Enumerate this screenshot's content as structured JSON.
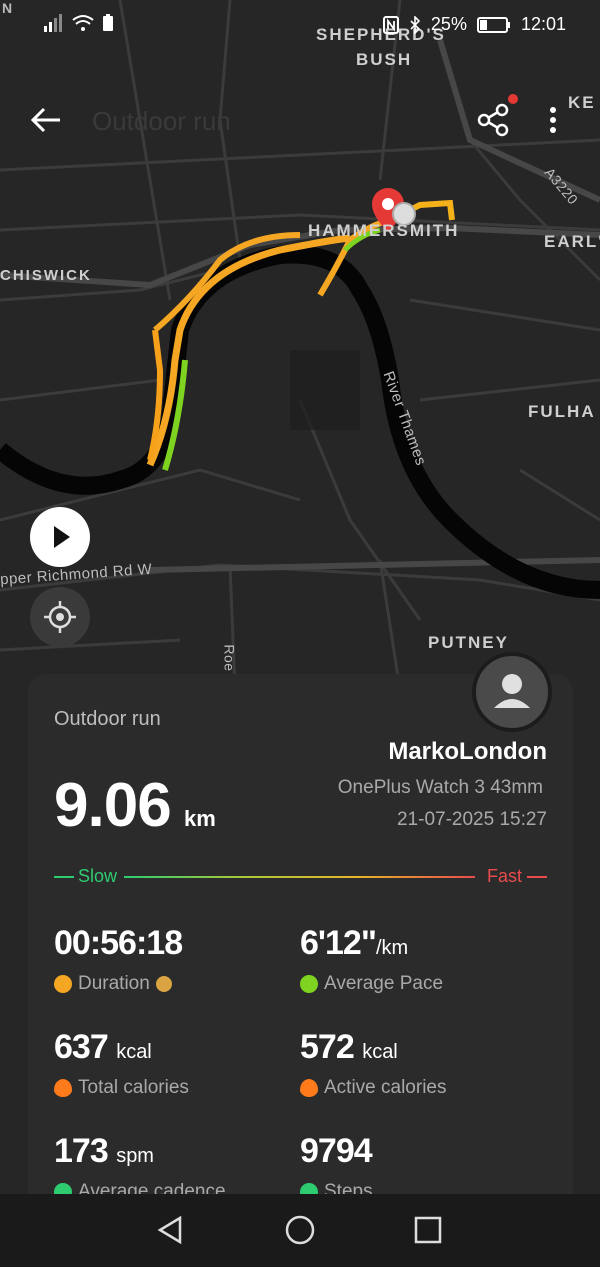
{
  "status_bar": {
    "corner": "N",
    "battery_percent": "25%",
    "time": "12:01"
  },
  "top_bar": {
    "faded_title": "Outdoor run",
    "icons": [
      "back-arrow-icon",
      "share-icon",
      "more-vertical-icon"
    ]
  },
  "map": {
    "labels": {
      "shepherds_bush_1": "SHEPHERD'S",
      "shepherds_bush_2": "BUSH",
      "hammersmith": "HAMMERSMITH",
      "chiswick": "CHISWICK",
      "fulham": "FULHA",
      "earls": "EARL'",
      "putney": "PUTNEY",
      "river": "River Thames",
      "road_a3220": "A3220",
      "upper_richmond": "pper Richmond Rd W",
      "ke": "KE",
      "roe": "Roe"
    },
    "controls": [
      "play-icon",
      "locate-icon"
    ]
  },
  "summary": {
    "title": "Outdoor run",
    "distance": "9.06",
    "distance_unit": "km",
    "username": "MarkoLondon",
    "device": "OnePlus Watch 3 43mm",
    "datetime": "21-07-2025 15:27",
    "legend_slow": "Slow",
    "legend_fast": "Fast",
    "stats": [
      {
        "value": "00:56:18",
        "unit": "",
        "label": "Duration"
      },
      {
        "value": "6'12\"",
        "unit": "/km",
        "label": "Average Pace"
      },
      {
        "value": "637",
        "unit": "kcal",
        "label": "Total calories"
      },
      {
        "value": "572",
        "unit": "kcal",
        "label": "Active calories"
      },
      {
        "value": "173",
        "unit": "spm",
        "label": "Average cadence"
      },
      {
        "value": "9794",
        "unit": "",
        "label": "Steps"
      }
    ]
  },
  "colors": {
    "slow": "#2ecc71",
    "fast": "#e84c4c",
    "route_orange": "#f5a623",
    "route_green": "#7ed321"
  }
}
